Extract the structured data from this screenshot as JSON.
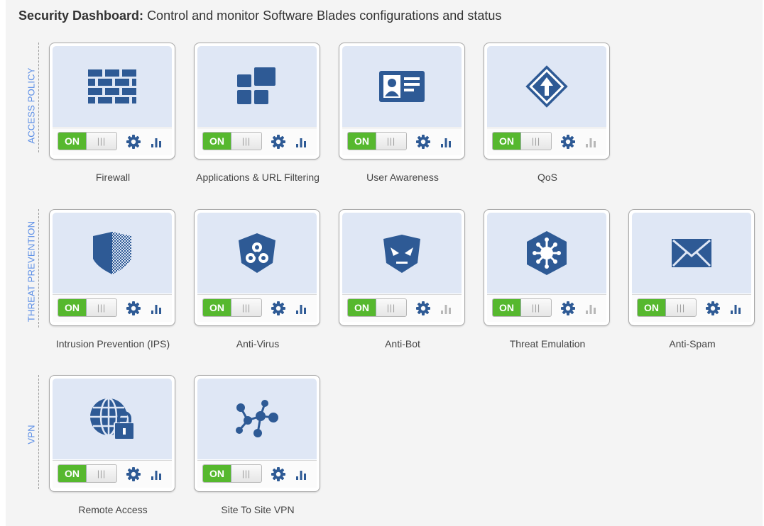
{
  "header": {
    "title": "Security Dashboard:",
    "subtitle": "Control and monitor Software Blades configurations and status"
  },
  "colors": {
    "accent": "#2e5a95",
    "on_green": "#56b82e",
    "section_label": "#5b8ee6",
    "icon_bg": "#dfe7f5"
  },
  "sections": [
    {
      "label": "ACCESS POLICY",
      "blades": [
        {
          "name": "Firewall",
          "icon": "firewall-icon",
          "toggle": "ON",
          "stats_active": true
        },
        {
          "name": "Applications & URL Filtering",
          "icon": "applications-icon",
          "toggle": "ON",
          "stats_active": true
        },
        {
          "name": "User Awareness",
          "icon": "user-card-icon",
          "toggle": "ON",
          "stats_active": true
        },
        {
          "name": "QoS",
          "icon": "qos-icon",
          "toggle": "ON",
          "stats_active": false
        }
      ]
    },
    {
      "label": "THREAT PREVENTION",
      "blades": [
        {
          "name": "Intrusion Prevention (IPS)",
          "icon": "shield-icon",
          "toggle": "ON",
          "stats_active": true
        },
        {
          "name": "Anti-Virus",
          "icon": "biohazard-icon",
          "toggle": "ON",
          "stats_active": true
        },
        {
          "name": "Anti-Bot",
          "icon": "bot-icon",
          "toggle": "ON",
          "stats_active": false
        },
        {
          "name": "Threat Emulation",
          "icon": "virus-icon",
          "toggle": "ON",
          "stats_active": false
        },
        {
          "name": "Anti-Spam",
          "icon": "envelope-icon",
          "toggle": "ON",
          "stats_active": true
        }
      ]
    },
    {
      "label": "VPN",
      "blades": [
        {
          "name": "Remote Access",
          "icon": "globe-lock-icon",
          "toggle": "ON",
          "stats_active": true
        },
        {
          "name": "Site To Site VPN",
          "icon": "network-icon",
          "toggle": "ON",
          "stats_active": true
        }
      ]
    }
  ]
}
